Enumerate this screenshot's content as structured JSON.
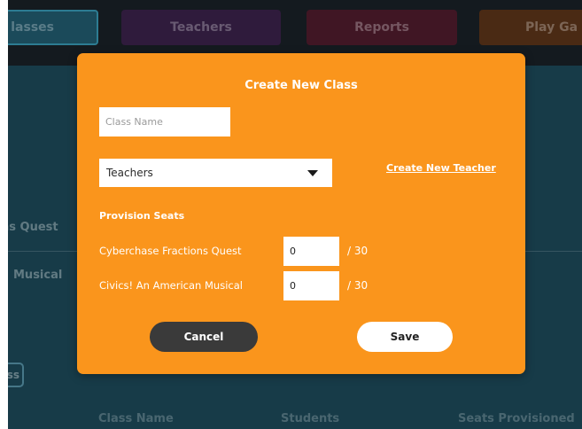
{
  "nav": {
    "tabs": [
      {
        "label": "lasses"
      },
      {
        "label": "Teachers"
      },
      {
        "label": "Reports"
      },
      {
        "label": "Play Ga"
      }
    ]
  },
  "background": {
    "games": [
      "ns Quest",
      "Musical"
    ],
    "button_fragment": "ss",
    "columns": [
      "Class Name",
      "Students",
      "Seats Provisioned"
    ]
  },
  "modal": {
    "title": "Create New Class",
    "class_name_placeholder": "Class Name",
    "class_name_value": "",
    "teachers_select": "Teachers",
    "create_teacher_link": "Create New Teacher",
    "provision_title": "Provision Seats",
    "seats": [
      {
        "game": "Cyberchase Fractions Quest",
        "value": "0",
        "max": "/ 30"
      },
      {
        "game": "Civics! An American Musical",
        "value": "0",
        "max": "/ 30"
      }
    ],
    "cancel_label": "Cancel",
    "save_label": "Save"
  },
  "colors": {
    "modal_bg": "#fa951c",
    "app_bg": "#173b48",
    "cancel_bg": "#3a3a3a"
  }
}
